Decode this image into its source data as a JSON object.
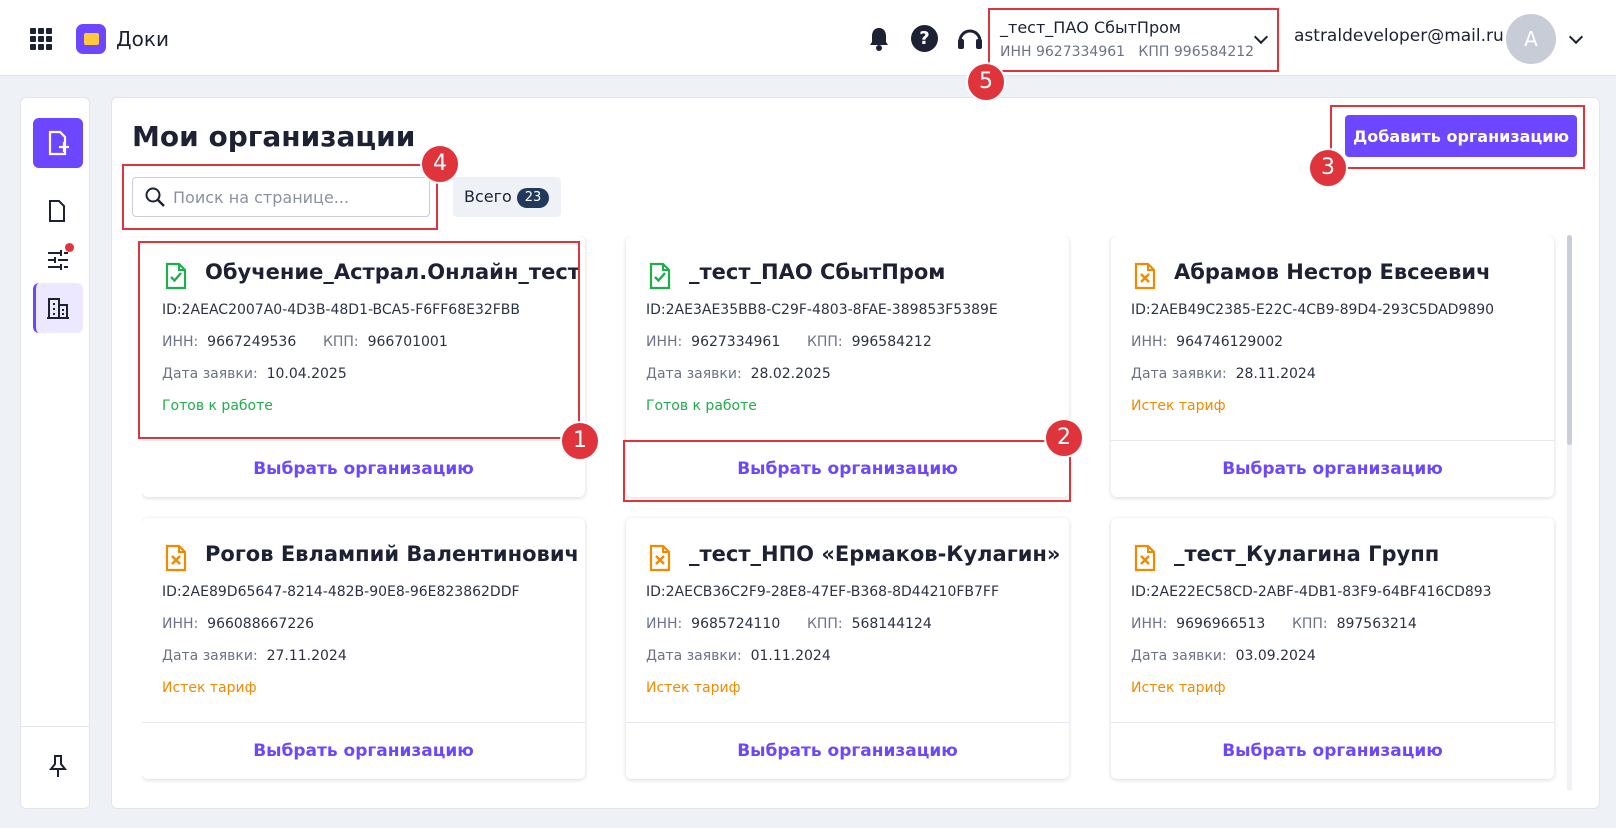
{
  "header": {
    "brand": "Доки",
    "org_switcher": {
      "name": "_тест_ПАО СбытПром",
      "inn_label": "ИНН",
      "inn": "9627334961",
      "kpp_label": "КПП",
      "kpp": "996584212"
    },
    "user": {
      "email": "astraldeveloper@mail.ru",
      "avatar_letter": "A"
    }
  },
  "page": {
    "title": "Мои организации",
    "add_button": "Добавить организацию",
    "search": {
      "placeholder": "Поиск на странице...",
      "value": ""
    },
    "filter": {
      "label": "Всего",
      "count": "23"
    }
  },
  "labels": {
    "id_prefix": "ID:",
    "inn": "ИНН:",
    "kpp": "КПП:",
    "date": "Дата заявки:",
    "select": "Выбрать организацию"
  },
  "colors": {
    "accent": "#6c47ff",
    "ready": "#1fae4b",
    "expired": "#f08a00",
    "highlight": "#e0343d"
  },
  "organizations": [
    {
      "name": "Обучение_Астрал.Онлайн_тест",
      "id": "2AEAC2007A0-4D3B-48D1-BCA5-F6FF68E32FBB",
      "inn": "9667249536",
      "kpp": "966701001",
      "date": "10.04.2025",
      "status": "Готов к работе",
      "status_type": "ready",
      "icon": "doc-check-icon"
    },
    {
      "name": "_тест_ПАО СбытПром",
      "id": "2AE3AE35BB8-C29F-4803-8FAE-389853F5389E",
      "inn": "9627334961",
      "kpp": "996584212",
      "date": "28.02.2025",
      "status": "Готов к работе",
      "status_type": "ready",
      "icon": "doc-check-icon"
    },
    {
      "name": "Абрамов Нестор Евсеевич",
      "id": "2AEB49C2385-E22C-4CB9-89D4-293C5DAD9890",
      "inn": "964746129002",
      "kpp": "",
      "date": "28.11.2024",
      "status": "Истек тариф",
      "status_type": "expired",
      "icon": "doc-cross-icon"
    },
    {
      "name": "Рогов Евлампий Валентинович",
      "id": "2AE89D65647-8214-482B-90E8-96E823862DDF",
      "inn": "966088667226",
      "kpp": "",
      "date": "27.11.2024",
      "status": "Истек тариф",
      "status_type": "expired",
      "icon": "doc-cross-icon"
    },
    {
      "name": "_тест_НПО «Ермаков-Кулагин»",
      "id": "2AECB36C2F9-28E8-47EF-B368-8D44210FB7FF",
      "inn": "9685724110",
      "kpp": "568144124",
      "date": "01.11.2024",
      "status": "Истек тариф",
      "status_type": "expired",
      "icon": "doc-cross-icon"
    },
    {
      "name": "_тест_Кулагина Групп",
      "id": "2AE22EC58CD-2ABF-4DB1-83F9-64BF416CD893",
      "inn": "9696966513",
      "kpp": "897563214",
      "date": "03.09.2024",
      "status": "Истек тариф",
      "status_type": "expired",
      "icon": "doc-cross-icon"
    }
  ],
  "markers": [
    "1",
    "2",
    "3",
    "4",
    "5"
  ]
}
